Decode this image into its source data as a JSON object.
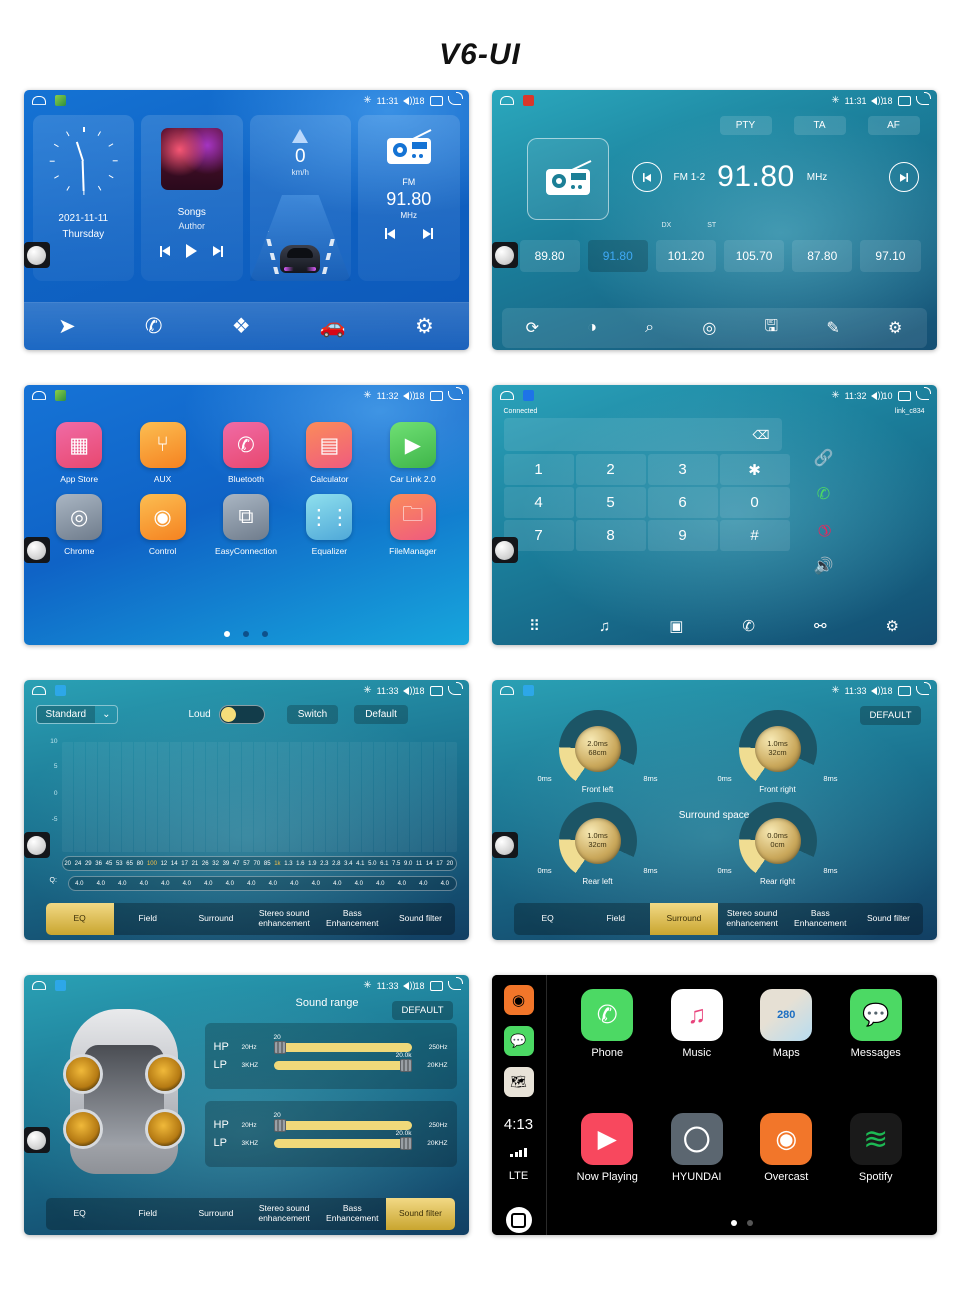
{
  "page": {
    "title": "V6-UI"
  },
  "statusbar": {
    "home_icon": "home-outline-icon",
    "bluetooth": "✳",
    "time_1131": "11:31",
    "time_1132": "11:32",
    "time_1133": "11:33",
    "volume_18": "18",
    "volume_10": "10"
  },
  "home": {
    "date": "2021-11-11",
    "day": "Thursday",
    "music_title": "Songs",
    "music_author": "Author",
    "speed_value": "0",
    "speed_unit": "km/h",
    "radio_band": "FM",
    "radio_freq": "91.80",
    "radio_unit": "MHz",
    "dock": [
      {
        "name": "navigation-icon",
        "glyph": "➤"
      },
      {
        "name": "phone-icon",
        "glyph": "✆"
      },
      {
        "name": "apps-icon",
        "glyph": "❖"
      },
      {
        "name": "carlink-icon",
        "glyph": "🚗"
      },
      {
        "name": "settings-icon",
        "glyph": "⚙"
      }
    ]
  },
  "radio": {
    "rds_buttons": [
      "PTY",
      "TA",
      "AF"
    ],
    "band": "FM 1-2",
    "frequency": "91.80",
    "unit": "MHz",
    "dx": "DX",
    "st": "ST",
    "presets": [
      "89.80",
      "91.80",
      "101.20",
      "105.70",
      "87.80",
      "97.10"
    ],
    "active_preset_index": 1,
    "dock": [
      {
        "name": "band-switch-icon",
        "glyph": "⟳"
      },
      {
        "name": "loc-dx-icon",
        "glyph": "◑"
      },
      {
        "name": "scan-search-icon",
        "glyph": "⌕"
      },
      {
        "name": "auto-scan-icon",
        "glyph": "◎"
      },
      {
        "name": "save-icon",
        "glyph": "🖫"
      },
      {
        "name": "edit-icon",
        "glyph": "✎"
      },
      {
        "name": "settings-icon",
        "glyph": "⚙"
      }
    ]
  },
  "apps": {
    "items": [
      {
        "label": "App Store",
        "icon": "app-store-icon",
        "glyph": "▦",
        "color1": "#f0629e",
        "color2": "#e8486f"
      },
      {
        "label": "AUX",
        "icon": "aux-icon",
        "glyph": "⑂",
        "color1": "#fbb040",
        "color2": "#f58220"
      },
      {
        "label": "Bluetooth",
        "icon": "bluetooth-phone-icon",
        "glyph": "✆",
        "color1": "#f0629e",
        "color2": "#e8486f"
      },
      {
        "label": "Calculator",
        "icon": "calculator-icon",
        "glyph": "▤",
        "color1": "#fb8c5a",
        "color2": "#ef5b7e"
      },
      {
        "label": "Car Link 2.0",
        "icon": "car-link-icon",
        "glyph": "▶",
        "color1": "#5bd061",
        "color2": "#3fb54a"
      },
      {
        "label": "Chrome",
        "icon": "chrome-icon",
        "glyph": "◎",
        "color1": "#9aa7b5",
        "color2": "#6f7c8c"
      },
      {
        "label": "Control",
        "icon": "steering-control-icon",
        "glyph": "◉",
        "color1": "#fbb040",
        "color2": "#f58220"
      },
      {
        "label": "EasyConnection",
        "icon": "easy-connection-icon",
        "glyph": "⧉",
        "color1": "#9aa7b5",
        "color2": "#6f7c8c"
      },
      {
        "label": "Equalizer",
        "icon": "equalizer-icon",
        "glyph": "⋮⋮",
        "color1": "#7fd6e8",
        "color2": "#4fa8d8"
      },
      {
        "label": "FileManager",
        "icon": "file-manager-icon",
        "glyph": "🗀",
        "color1": "#fb8c5a",
        "color2": "#ef5b7e"
      }
    ],
    "page_dots": 3,
    "active_dot": 0
  },
  "bluetooth": {
    "status": "Connected",
    "device": "link_c834",
    "keys": [
      "1",
      "2",
      "3",
      "✱",
      "4",
      "5",
      "6",
      "0",
      "7",
      "8",
      "9",
      "#"
    ],
    "backspace": "⌫",
    "side_buttons": [
      {
        "name": "link-icon",
        "glyph": "🔗"
      },
      {
        "name": "call-answer-icon",
        "glyph": "✆"
      },
      {
        "name": "call-end-icon",
        "glyph": "✆"
      },
      {
        "name": "speaker-icon",
        "glyph": "🔊"
      }
    ],
    "dock": [
      {
        "name": "keypad-icon",
        "glyph": "⠿"
      },
      {
        "name": "music-icon",
        "glyph": "♫"
      },
      {
        "name": "contacts-icon",
        "glyph": "▣"
      },
      {
        "name": "call-history-icon",
        "glyph": "✆"
      },
      {
        "name": "connect-icon",
        "glyph": "⚯"
      },
      {
        "name": "settings-icon",
        "glyph": "⚙"
      }
    ]
  },
  "audio_tabs": [
    "EQ",
    "Field",
    "Surround",
    "Stereo sound enhancement",
    "Bass Enhancement",
    "Sound filter"
  ],
  "eq": {
    "preset": "Standard",
    "dropdown_arrow": "⌄",
    "loud_label": "Loud",
    "switch_label": "Switch",
    "default_label": "Default",
    "active_tab": "EQ",
    "y_axis": [
      "10",
      "5",
      "0",
      "-5"
    ],
    "frequencies": [
      "20",
      "24",
      "29",
      "36",
      "45",
      "53",
      "65",
      "80",
      "100",
      "12",
      "14",
      "17",
      "21",
      "26",
      "32",
      "39",
      "47",
      "57",
      "70",
      "85",
      "1k",
      "1.3",
      "1.6",
      "1.9",
      "2.3",
      "2.8",
      "3.4",
      "4.1",
      "5.0",
      "6.1",
      "7.5",
      "9.0",
      "11",
      "14",
      "17",
      "20"
    ],
    "highlighted_frequencies": [
      "100",
      "1k"
    ],
    "q_label": "Q:",
    "q_values": [
      "4.0",
      "4.0",
      "4.0",
      "4.0",
      "4.0",
      "4.0",
      "4.0",
      "4.0",
      "4.0",
      "4.0",
      "4.0",
      "4.0",
      "4.0",
      "4.0",
      "4.0",
      "4.0",
      "4.0",
      "4.0"
    ]
  },
  "surround": {
    "title": "Surround space",
    "default_label": "DEFAULT",
    "active_tab": "Surround",
    "knobs": [
      {
        "label": "Front left",
        "delay": "2.0ms",
        "distance": "68cm",
        "min": "0ms",
        "max": "8ms"
      },
      {
        "label": "Front right",
        "delay": "1.0ms",
        "distance": "32cm",
        "min": "0ms",
        "max": "8ms"
      },
      {
        "label": "Rear left",
        "delay": "1.0ms",
        "distance": "32cm",
        "min": "0ms",
        "max": "8ms"
      },
      {
        "label": "Rear right",
        "delay": "0.0ms",
        "distance": "0cm",
        "min": "0ms",
        "max": "8ms"
      }
    ]
  },
  "sound_filter": {
    "title": "Sound range",
    "default_label": "DEFAULT",
    "active_tab": "Sound filter",
    "groups": [
      {
        "rows": [
          {
            "name": "HP",
            "min": "20Hz",
            "max": "250Hz",
            "value": "20",
            "pos": 0
          },
          {
            "name": "LP",
            "min": "3KHZ",
            "max": "20KHZ",
            "value": "20.0k",
            "pos": 100
          }
        ]
      },
      {
        "rows": [
          {
            "name": "HP",
            "min": "20Hz",
            "max": "250Hz",
            "value": "20",
            "pos": 0
          },
          {
            "name": "LP",
            "min": "3KHZ",
            "max": "20KHZ",
            "value": "20.0k",
            "pos": 100
          }
        ]
      }
    ]
  },
  "carplay": {
    "time": "4:13",
    "network": "LTE",
    "sidebar": [
      {
        "name": "overcast-icon",
        "glyph": "◉",
        "color": "#f2762a"
      },
      {
        "name": "messages-icon",
        "glyph": "💬",
        "color": "#4cd964"
      },
      {
        "name": "maps-icon",
        "glyph": "🗺",
        "color": "#e8e3d8"
      }
    ],
    "apps": [
      {
        "label": "Phone",
        "icon": "phone-icon",
        "glyph": "✆",
        "color": "#4cd964"
      },
      {
        "label": "Music",
        "icon": "music-icon",
        "glyph": "♫",
        "color": "#ffffff"
      },
      {
        "label": "Maps",
        "icon": "maps-icon",
        "glyph": "280",
        "color": "#e9e4d9"
      },
      {
        "label": "Messages",
        "icon": "messages-icon",
        "glyph": "💬",
        "color": "#4cd964"
      },
      {
        "label": "Now Playing",
        "icon": "now-playing-icon",
        "glyph": "▶",
        "color": "#f8485e"
      },
      {
        "label": "HYUNDAI",
        "icon": "hyundai-icon",
        "glyph": "〇",
        "color": "#5b6670"
      },
      {
        "label": "Overcast",
        "icon": "overcast-icon",
        "glyph": "◉",
        "color": "#f2762a"
      },
      {
        "label": "Spotify",
        "icon": "spotify-icon",
        "glyph": "≋",
        "color": "#1db954"
      }
    ],
    "page_dots": 2,
    "active_dot": 0
  }
}
